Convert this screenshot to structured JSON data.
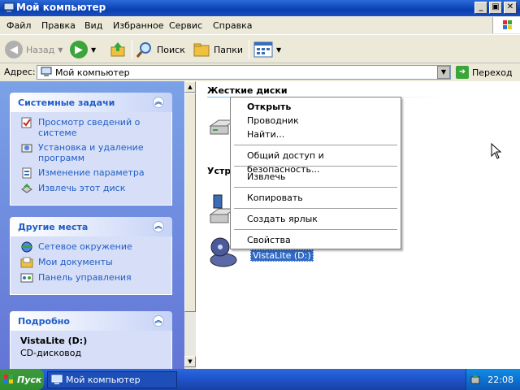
{
  "window": {
    "title": "Мой компьютер"
  },
  "titlebar": {
    "minimize": "_",
    "maximize": "▣",
    "close": "✕"
  },
  "menubar": {
    "items": [
      "Файл",
      "Правка",
      "Вид",
      "Избранное",
      "Сервис",
      "Справка"
    ]
  },
  "toolbar": {
    "back_label": "Назад",
    "search_label": "Поиск",
    "folders_label": "Папки"
  },
  "address": {
    "label": "Адрес:",
    "value": "Мой компьютер",
    "go_label": "Переход"
  },
  "left_panels": {
    "system_tasks": {
      "title": "Системные задачи",
      "items": [
        "Просмотр сведений о системе",
        "Установка и удаление программ",
        "Изменение параметра",
        "Извлечь этот диск"
      ]
    },
    "other_places": {
      "title": "Другие места",
      "items": [
        "Сетевое окружение",
        "Мои документы",
        "Панель управления"
      ]
    },
    "details": {
      "title": "Подробно",
      "name": "VistaLite (D:)",
      "type": "CD-дисковод"
    }
  },
  "content": {
    "group_hard_drives": "Жесткие диски",
    "group_devices": "Устр",
    "selected_drive_label": "VistaLite (D:)"
  },
  "context_menu": {
    "items": [
      "Открыть",
      "Проводник",
      "Найти...",
      "Общий доступ и безопасность...",
      "Извлечь",
      "Копировать",
      "Создать ярлык",
      "Свойства"
    ]
  },
  "taskbar": {
    "start_label": "Пуск",
    "task_label": "Мой компьютер",
    "clock": "22:08"
  },
  "colors": {
    "title_blue": "#0a3fb0",
    "selection": "#316ac5",
    "panel_link": "#215dc6",
    "start_green": "#2f8f2f"
  }
}
